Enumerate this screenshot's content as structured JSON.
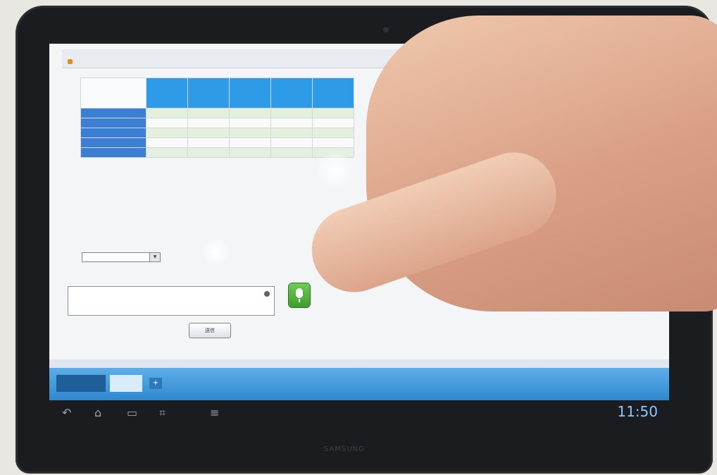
{
  "screen": {
    "submit_label": "送信",
    "clock": "11:50",
    "brand": "SAMSUNG"
  },
  "icons": [
    "mic-icon",
    "back-icon",
    "home-icon",
    "recent-apps-icon",
    "screenshot-icon",
    "menu-icon",
    "wifi-icon"
  ],
  "colors": {
    "table_header": "#2d9be7",
    "row_label": "#3a7fd3",
    "taskbar": "#3089cf",
    "mic_button": "#4caf3a"
  }
}
